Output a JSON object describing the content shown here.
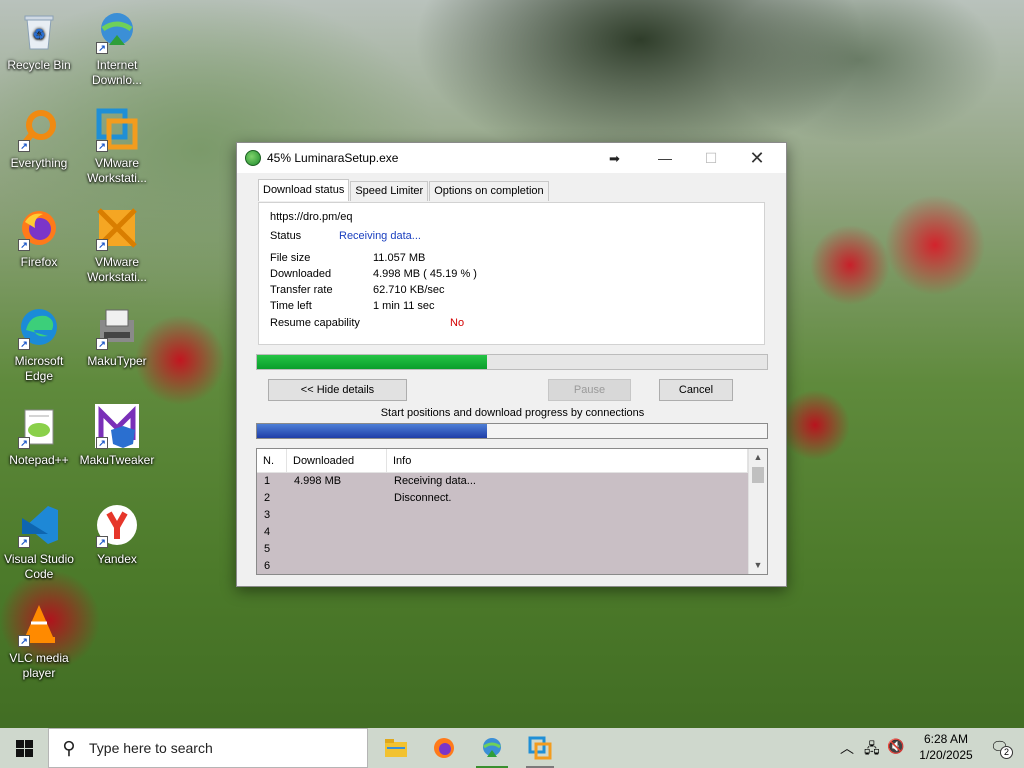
{
  "desktop": {
    "icons": [
      {
        "label": "Recycle Bin",
        "icon": "recycle-bin-icon"
      },
      {
        "label": "Internet Downlo...",
        "icon": "idm-icon"
      },
      {
        "label": "Everything",
        "icon": "everything-search-icon"
      },
      {
        "label": "VMware Workstati...",
        "icon": "vmware-icon"
      },
      {
        "label": "Firefox",
        "icon": "firefox-icon"
      },
      {
        "label": "VMware Workstati...",
        "icon": "vmware-player-icon"
      },
      {
        "label": "Microsoft Edge",
        "icon": "edge-icon"
      },
      {
        "label": "MakuTyper",
        "icon": "makutyper-icon"
      },
      {
        "label": "Notepad++",
        "icon": "notepadpp-icon"
      },
      {
        "label": "MakuTweaker",
        "icon": "makutweaker-icon"
      },
      {
        "label": "Visual Studio Code",
        "icon": "vscode-icon"
      },
      {
        "label": "Yandex",
        "icon": "yandex-icon"
      },
      {
        "label": "VLC media player",
        "icon": "vlc-icon"
      }
    ]
  },
  "window": {
    "title": "45% LuminaraSetup.exe",
    "close_symbol": "✕",
    "minimize_symbol": "—",
    "maximize_symbol": "☐",
    "tabs": [
      {
        "label": "Download status",
        "active": true
      },
      {
        "label": "Speed Limiter",
        "active": false
      },
      {
        "label": "Options on completion",
        "active": false
      }
    ],
    "url": "https://dro.pm/eq",
    "status_label": "Status",
    "status_value": "Receiving data...",
    "details": [
      {
        "label": "File size",
        "value": "11.057  MB"
      },
      {
        "label": "Downloaded",
        "value": "4.998  MB  ( 45.19 % )"
      },
      {
        "label": "Transfer rate",
        "value": "62.710  KB/sec"
      },
      {
        "label": "Time left",
        "value": "1 min 11 sec"
      },
      {
        "label": "Resume capability",
        "value": "No"
      }
    ],
    "progress_percent": 45.19,
    "buttons": {
      "hide_details": "<< Hide details",
      "pause": "Pause",
      "cancel": "Cancel"
    },
    "connections_caption": "Start positions and download progress by connections",
    "connections_progress_percent": 45.19,
    "connections_table": {
      "columns": [
        "N.",
        "Downloaded",
        "Info"
      ],
      "rows": [
        {
          "n": "1",
          "downloaded": "4.998  MB",
          "info": "Receiving data..."
        },
        {
          "n": "2",
          "downloaded": "",
          "info": "Disconnect."
        },
        {
          "n": "3",
          "downloaded": "",
          "info": ""
        },
        {
          "n": "4",
          "downloaded": "",
          "info": ""
        },
        {
          "n": "5",
          "downloaded": "",
          "info": ""
        },
        {
          "n": "6",
          "downloaded": "",
          "info": ""
        }
      ]
    }
  },
  "taskbar": {
    "search_placeholder": "Type here to search",
    "apps": [
      "file-explorer-icon",
      "firefox-icon",
      "idm-icon",
      "vmware-icon"
    ],
    "clock_time": "6:28 AM",
    "clock_date": "1/20/2025",
    "notification_count": "2"
  },
  "colors": {
    "progress_green": "#0fae35",
    "progress_blue": "#2a4fb8",
    "status_blue": "#1a3fbf",
    "resume_red": "#d40000"
  }
}
